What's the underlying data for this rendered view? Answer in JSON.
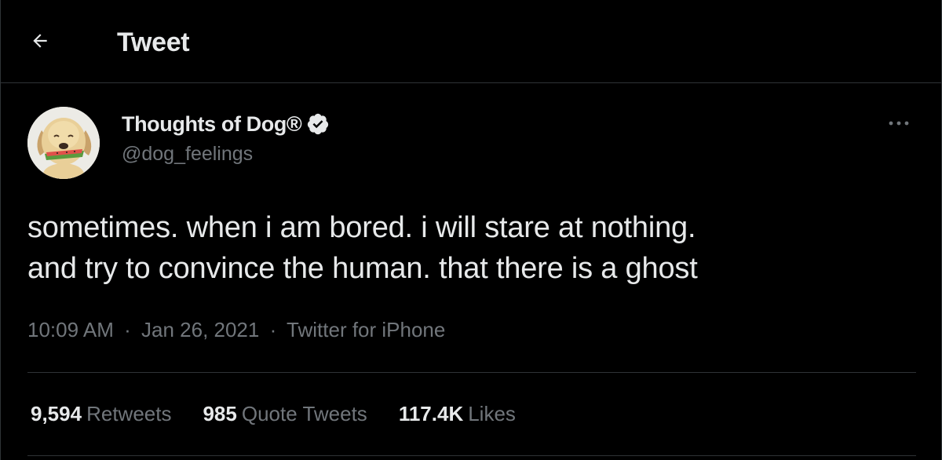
{
  "header": {
    "title": "Tweet",
    "back_icon": "arrow-left-icon"
  },
  "author": {
    "name": "Thoughts of Dog®",
    "handle": "@dog_feelings",
    "verified": true,
    "avatar_icon": "dog-avatar",
    "more_icon": "more-horizontal-icon"
  },
  "tweet": {
    "lines": [
      "sometimes. when i am bored. i will stare at nothing.",
      "and try to convince the human. that there is a ghost"
    ]
  },
  "meta": {
    "time": "10:09 AM",
    "date": "Jan 26, 2021",
    "source": "Twitter for iPhone",
    "separator": "·"
  },
  "stats": [
    {
      "count": "9,594",
      "label": "Retweets"
    },
    {
      "count": "985",
      "label": "Quote Tweets"
    },
    {
      "count": "117.4K",
      "label": "Likes"
    }
  ],
  "colors": {
    "background": "#000000",
    "text_primary": "#e7e9ea",
    "text_secondary": "#71767b",
    "divider": "#2f3336",
    "verified_badge": "#e7e9ea"
  }
}
